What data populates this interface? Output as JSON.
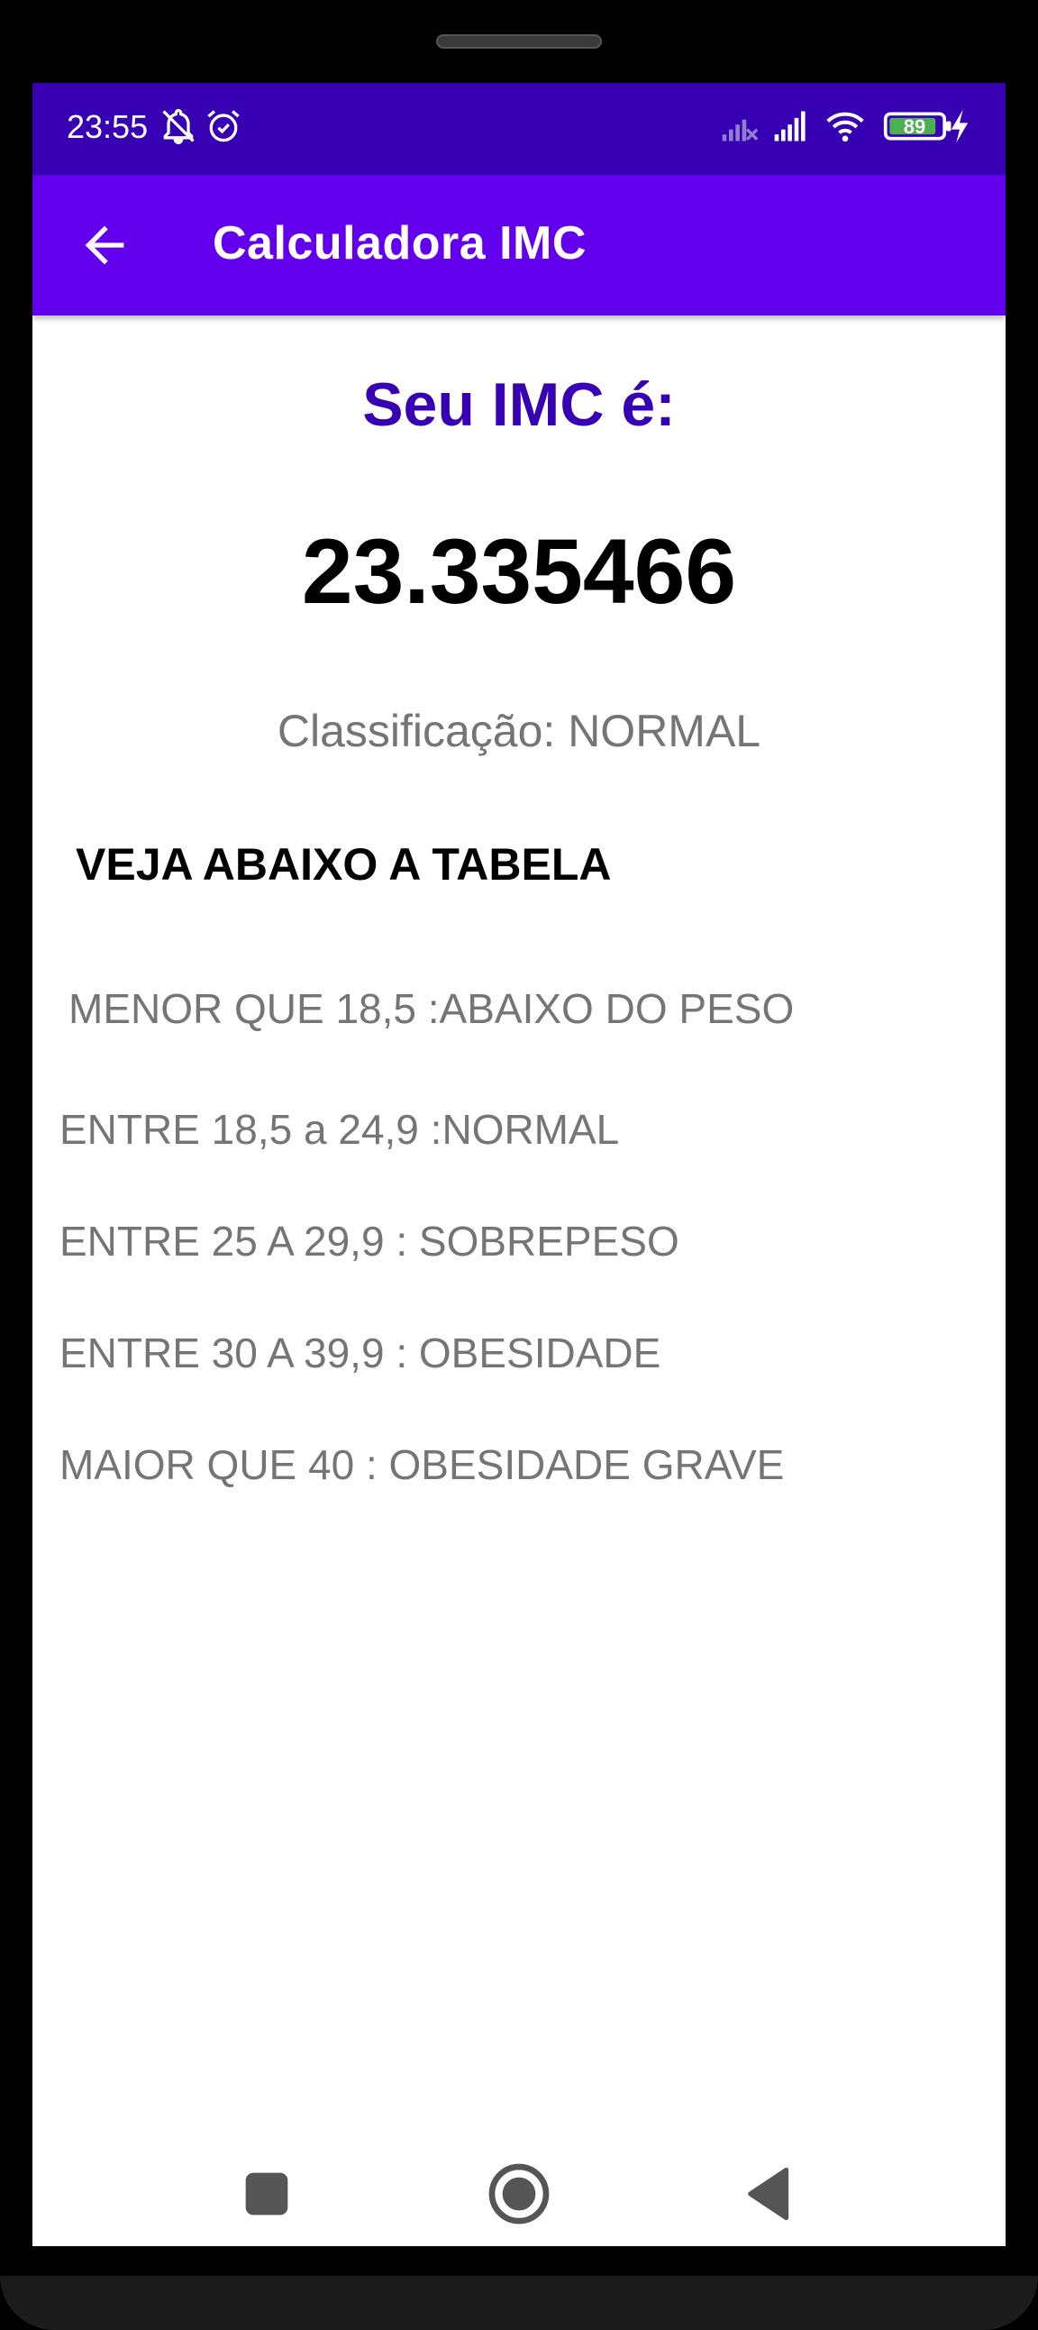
{
  "status_bar": {
    "time": "23:55",
    "icons": [
      "bell-off-icon",
      "alarm-icon",
      "signal-off-icon",
      "signal-icon",
      "wifi-icon",
      "battery-icon",
      "charging-icon"
    ],
    "battery_level": "89",
    "colors": {
      "background": "#3700b3",
      "battery_fill": "#4caf50"
    }
  },
  "app_bar": {
    "back_icon": "arrow-left-icon",
    "title": "Calculadora IMC",
    "colors": {
      "background": "#6200ee"
    }
  },
  "result": {
    "heading": "Seu IMC é:",
    "value": "23.335466",
    "classification": "Classificação: NORMAL"
  },
  "table": {
    "title": "VEJA ABAIXO A TABELA",
    "rows": [
      "MENOR QUE 18,5 :ABAIXO DO PESO",
      "ENTRE 18,5 a 24,9 :NORMAL",
      "ENTRE 25 A 29,9 : SOBREPESO",
      "ENTRE 30 A 39,9 : OBESIDADE",
      "MAIOR QUE 40 : OBESIDADE GRAVE"
    ]
  },
  "nav_bar": {
    "buttons": [
      "recents-square-icon",
      "home-circle-icon",
      "back-triangle-icon"
    ]
  }
}
